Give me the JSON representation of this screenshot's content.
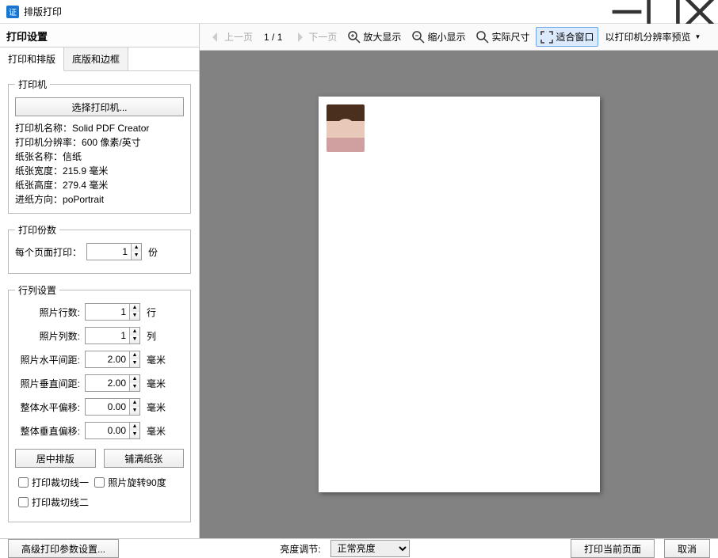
{
  "window": {
    "title": "排版打印"
  },
  "sidebar": {
    "header": "打印设置",
    "tabs": {
      "layout": "打印和排版",
      "border": "底版和边框"
    },
    "printer": {
      "legend": "打印机",
      "select_btn": "选择打印机...",
      "name_label": "打印机名称：",
      "name_value": "Solid PDF Creator",
      "res_label": "打印机分辨率：",
      "res_value": "600 像素/英寸",
      "paper_name_label": "纸张名称：",
      "paper_name_value": "信纸",
      "paper_w_label": "纸张宽度：",
      "paper_w_value": "215.9 毫米",
      "paper_h_label": "纸张高度：",
      "paper_h_value": "279.4 毫米",
      "orient_label": "进纸方向：",
      "orient_value": "poPortrait"
    },
    "copies": {
      "legend": "打印份数",
      "label": "每个页面打印：",
      "value": "1",
      "unit": "份"
    },
    "grid": {
      "legend": "行列设置",
      "rows_label": "照片行数:",
      "rows_value": "1",
      "rows_unit": "行",
      "cols_label": "照片列数:",
      "cols_value": "1",
      "cols_unit": "列",
      "hgap_label": "照片水平间距:",
      "hgap_value": "2.00",
      "hgap_unit": "毫米",
      "vgap_label": "照片垂直间距:",
      "vgap_value": "2.00",
      "vgap_unit": "毫米",
      "hoff_label": "整体水平偏移:",
      "hoff_value": "0.00",
      "hoff_unit": "毫米",
      "voff_label": "整体垂直偏移:",
      "voff_value": "0.00",
      "voff_unit": "毫米",
      "center_btn": "居中排版",
      "fill_btn": "铺满纸张",
      "cb_cut1": "打印裁切线一",
      "cb_rotate90": "照片旋转90度",
      "cb_cut2": "打印裁切线二"
    }
  },
  "toolbar": {
    "prev": "上一页",
    "page_current": "1",
    "page_total": "1",
    "next": "下一页",
    "zoom_in": "放大显示",
    "zoom_out": "缩小显示",
    "actual": "实际尺寸",
    "fit": "适合窗口",
    "preview_res": "以打印机分辨率预览"
  },
  "footer": {
    "advanced": "高级打印参数设置...",
    "brightness_label": "亮度调节:",
    "brightness_value": "正常亮度",
    "print_page": "打印当前页面",
    "cancel": "取消"
  }
}
